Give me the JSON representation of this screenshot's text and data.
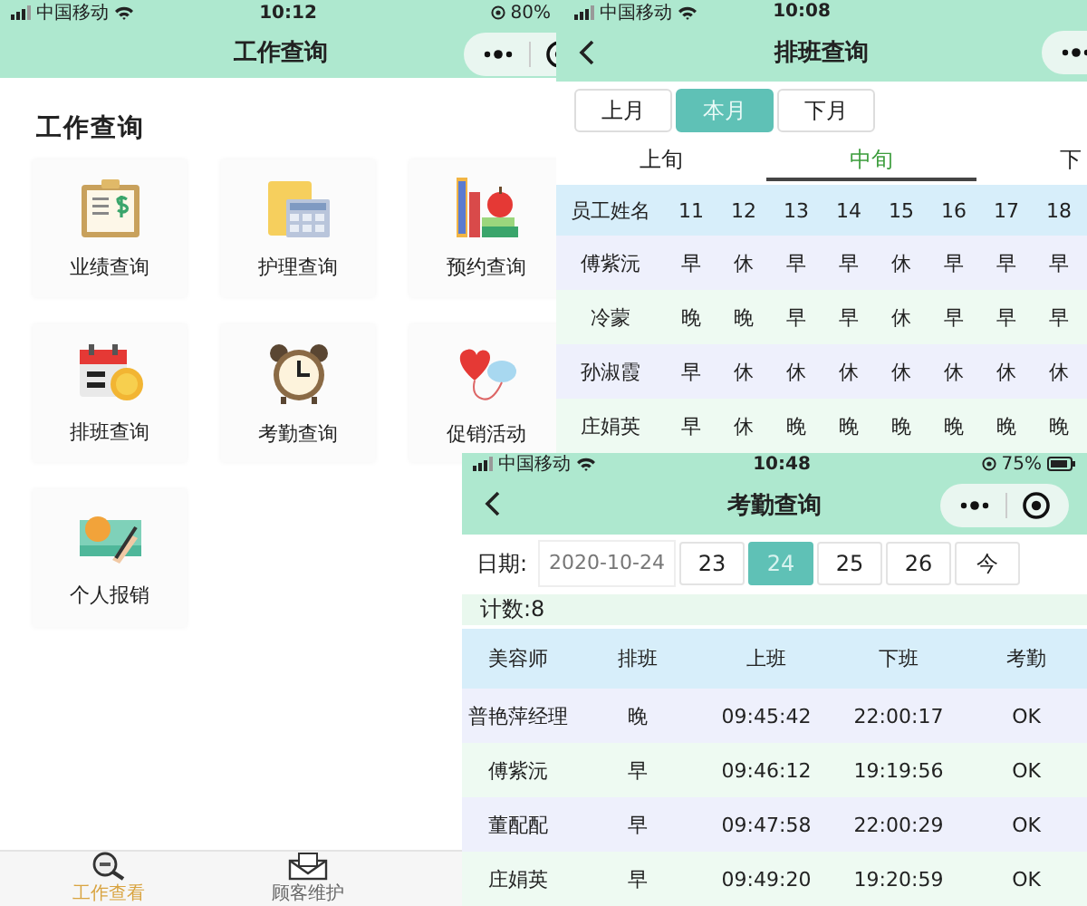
{
  "work_query_screen": {
    "status_bar": {
      "carrier": "中国移动",
      "time": "10:12",
      "battery": "80%"
    },
    "title": "工作查询",
    "section_title": "工作查询",
    "tiles": [
      {
        "label": "业绩查询"
      },
      {
        "label": "护理查询"
      },
      {
        "label": "预约查询"
      },
      {
        "label": "排班查询"
      },
      {
        "label": "考勤查询"
      },
      {
        "label": "促销活动"
      },
      {
        "label": "个人报销"
      }
    ],
    "tab_bar": [
      {
        "label": "工作查看",
        "selected": true
      },
      {
        "label": "顾客维护",
        "selected": false
      }
    ]
  },
  "schedule_screen": {
    "status_bar": {
      "carrier": "中国移动",
      "time": "10:08"
    },
    "title": "排班查询",
    "month_buttons": [
      {
        "label": "上月",
        "selected": false
      },
      {
        "label": "本月",
        "selected": true
      },
      {
        "label": "下月",
        "selected": false
      }
    ],
    "period_tabs": [
      {
        "label": "上旬",
        "selected": false
      },
      {
        "label": "中旬",
        "selected": true
      },
      {
        "label": "下",
        "selected": false
      }
    ],
    "table": {
      "columns": [
        "员工姓名",
        "11",
        "12",
        "13",
        "14",
        "15",
        "16",
        "17",
        "18"
      ],
      "rows": [
        [
          "傅紫沅",
          "早",
          "休",
          "早",
          "早",
          "休",
          "早",
          "早",
          "早"
        ],
        [
          "冷蒙",
          "晚",
          "晚",
          "早",
          "早",
          "休",
          "早",
          "早",
          "早"
        ],
        [
          "孙淑霞",
          "早",
          "休",
          "休",
          "休",
          "休",
          "休",
          "休",
          "休"
        ],
        [
          "庄娟英",
          "早",
          "休",
          "晚",
          "晚",
          "晚",
          "晚",
          "晚",
          "晚"
        ]
      ]
    }
  },
  "attendance_screen": {
    "status_bar": {
      "carrier": "中国移动",
      "time": "10:48",
      "battery": "75%"
    },
    "title": "考勤查询",
    "date_label": "日期:",
    "date_value": "2020-10-24",
    "day_buttons": [
      {
        "label": "23",
        "selected": false
      },
      {
        "label": "24",
        "selected": true
      },
      {
        "label": "25",
        "selected": false
      },
      {
        "label": "26",
        "selected": false
      },
      {
        "label": "今",
        "selected": false
      }
    ],
    "count": "计数:8",
    "table": {
      "columns": [
        "美容师",
        "排班",
        "上班",
        "下班",
        "考勤"
      ],
      "rows": [
        [
          "普艳萍经理",
          "晚",
          "09:45:42",
          "22:00:17",
          "OK"
        ],
        [
          "傅紫沅",
          "早",
          "09:46:12",
          "19:19:56",
          "OK"
        ],
        [
          "董配配",
          "早",
          "09:47:58",
          "22:00:29",
          "OK"
        ],
        [
          "庄娟英",
          "早",
          "09:49:20",
          "19:20:59",
          "OK"
        ]
      ]
    }
  }
}
